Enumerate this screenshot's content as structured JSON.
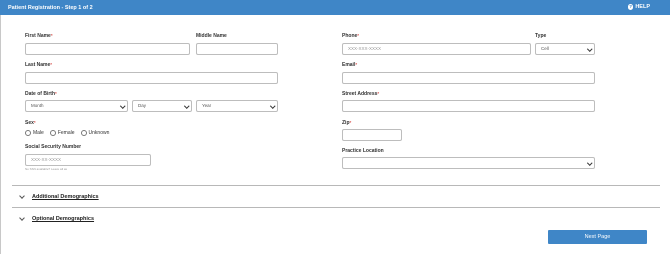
{
  "header": {
    "title": "Patient Registration - Step 1 of 2",
    "help_label": "HELP",
    "help_icon": "?"
  },
  "colors": {
    "accent": "#3f86c7",
    "required": "#d9534f"
  },
  "required_marker": "*",
  "form": {
    "first_name": {
      "label": "First Name",
      "required": true,
      "value": ""
    },
    "middle_name": {
      "label": "Middle Name",
      "value": ""
    },
    "last_name": {
      "label": "Last Name",
      "required": true,
      "value": ""
    },
    "dob": {
      "label": "Date of Birth",
      "required": true,
      "month": "Month",
      "day": "Day",
      "year": "Year"
    },
    "sex": {
      "label": "Sex",
      "required": true,
      "options": [
        "Male",
        "Female",
        "Unknown"
      ],
      "selected": null
    },
    "ssn": {
      "label": "Social Security Number",
      "placeholder": "XXX-XX-XXXX",
      "hint": "No SSN available? Leave all as"
    },
    "phone": {
      "label": "Phone",
      "required": true,
      "placeholder": "XXX-XXX-XXXX"
    },
    "phone_type": {
      "label": "Type",
      "selected": "Cell"
    },
    "email": {
      "label": "Email",
      "required": true,
      "value": ""
    },
    "street_address": {
      "label": "Street Address",
      "required": true,
      "value": ""
    },
    "zip": {
      "label": "Zip",
      "required": true,
      "value": ""
    },
    "practice_location": {
      "label": "Practice Location",
      "selected": ""
    }
  },
  "sections": [
    {
      "label": "Additional Demographics",
      "icon": "chevron-down-icon"
    },
    {
      "label": "Optional Demographics",
      "icon": "chevron-down-icon"
    }
  ],
  "actions": {
    "next_label": "Next Page"
  }
}
